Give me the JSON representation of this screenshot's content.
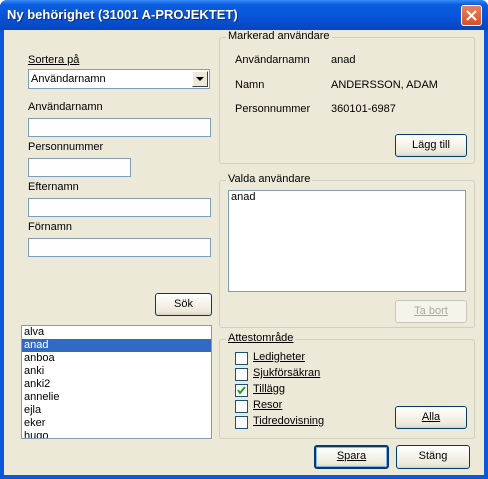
{
  "window": {
    "title": "Ny behörighet (31001 A-PROJEKTET)"
  },
  "search": {
    "sort_label": "Sortera på",
    "sort_value": "Användarnamn",
    "username_label": "Användarnamn",
    "username_value": "",
    "personnummer_label": "Personnummer",
    "personnummer_value": "",
    "efternamn_label": "Efternamn",
    "efternamn_value": "",
    "fornamn_label": "Förnamn",
    "fornamn_value": "",
    "search_button": "Sök"
  },
  "user_list": {
    "items": [
      "alva",
      "anad",
      "anboa",
      "anki",
      "anki2",
      "annelie",
      "ejla",
      "eker",
      "hugo"
    ],
    "selected": "anad"
  },
  "marked_user": {
    "group_title": "Markerad användare",
    "username_label": "Användarnamn",
    "username_value": "anad",
    "name_label": "Namn",
    "name_value": "ANDERSSON, ADAM",
    "pnr_label": "Personnummer",
    "pnr_value": "360101-6987",
    "add_button": "Lägg till"
  },
  "selected_users": {
    "group_title": "Valda användare",
    "items": [
      "anad"
    ],
    "remove_button": "Ta bort"
  },
  "attest": {
    "group_title": "Attestområde",
    "options": [
      {
        "label": "Ledigheter",
        "checked": false
      },
      {
        "label": "Sjukförsäkran",
        "checked": false
      },
      {
        "label": "Tillägg",
        "checked": true
      },
      {
        "label": "Resor",
        "checked": false
      },
      {
        "label": "Tidredovisning",
        "checked": false
      }
    ],
    "all_button": "Alla"
  },
  "footer": {
    "save_button": "Spara",
    "close_button": "Stäng"
  },
  "colors": {
    "titlebar": "#0852d6",
    "dialog_bg": "#ece9d8",
    "selection": "#316ac5"
  }
}
